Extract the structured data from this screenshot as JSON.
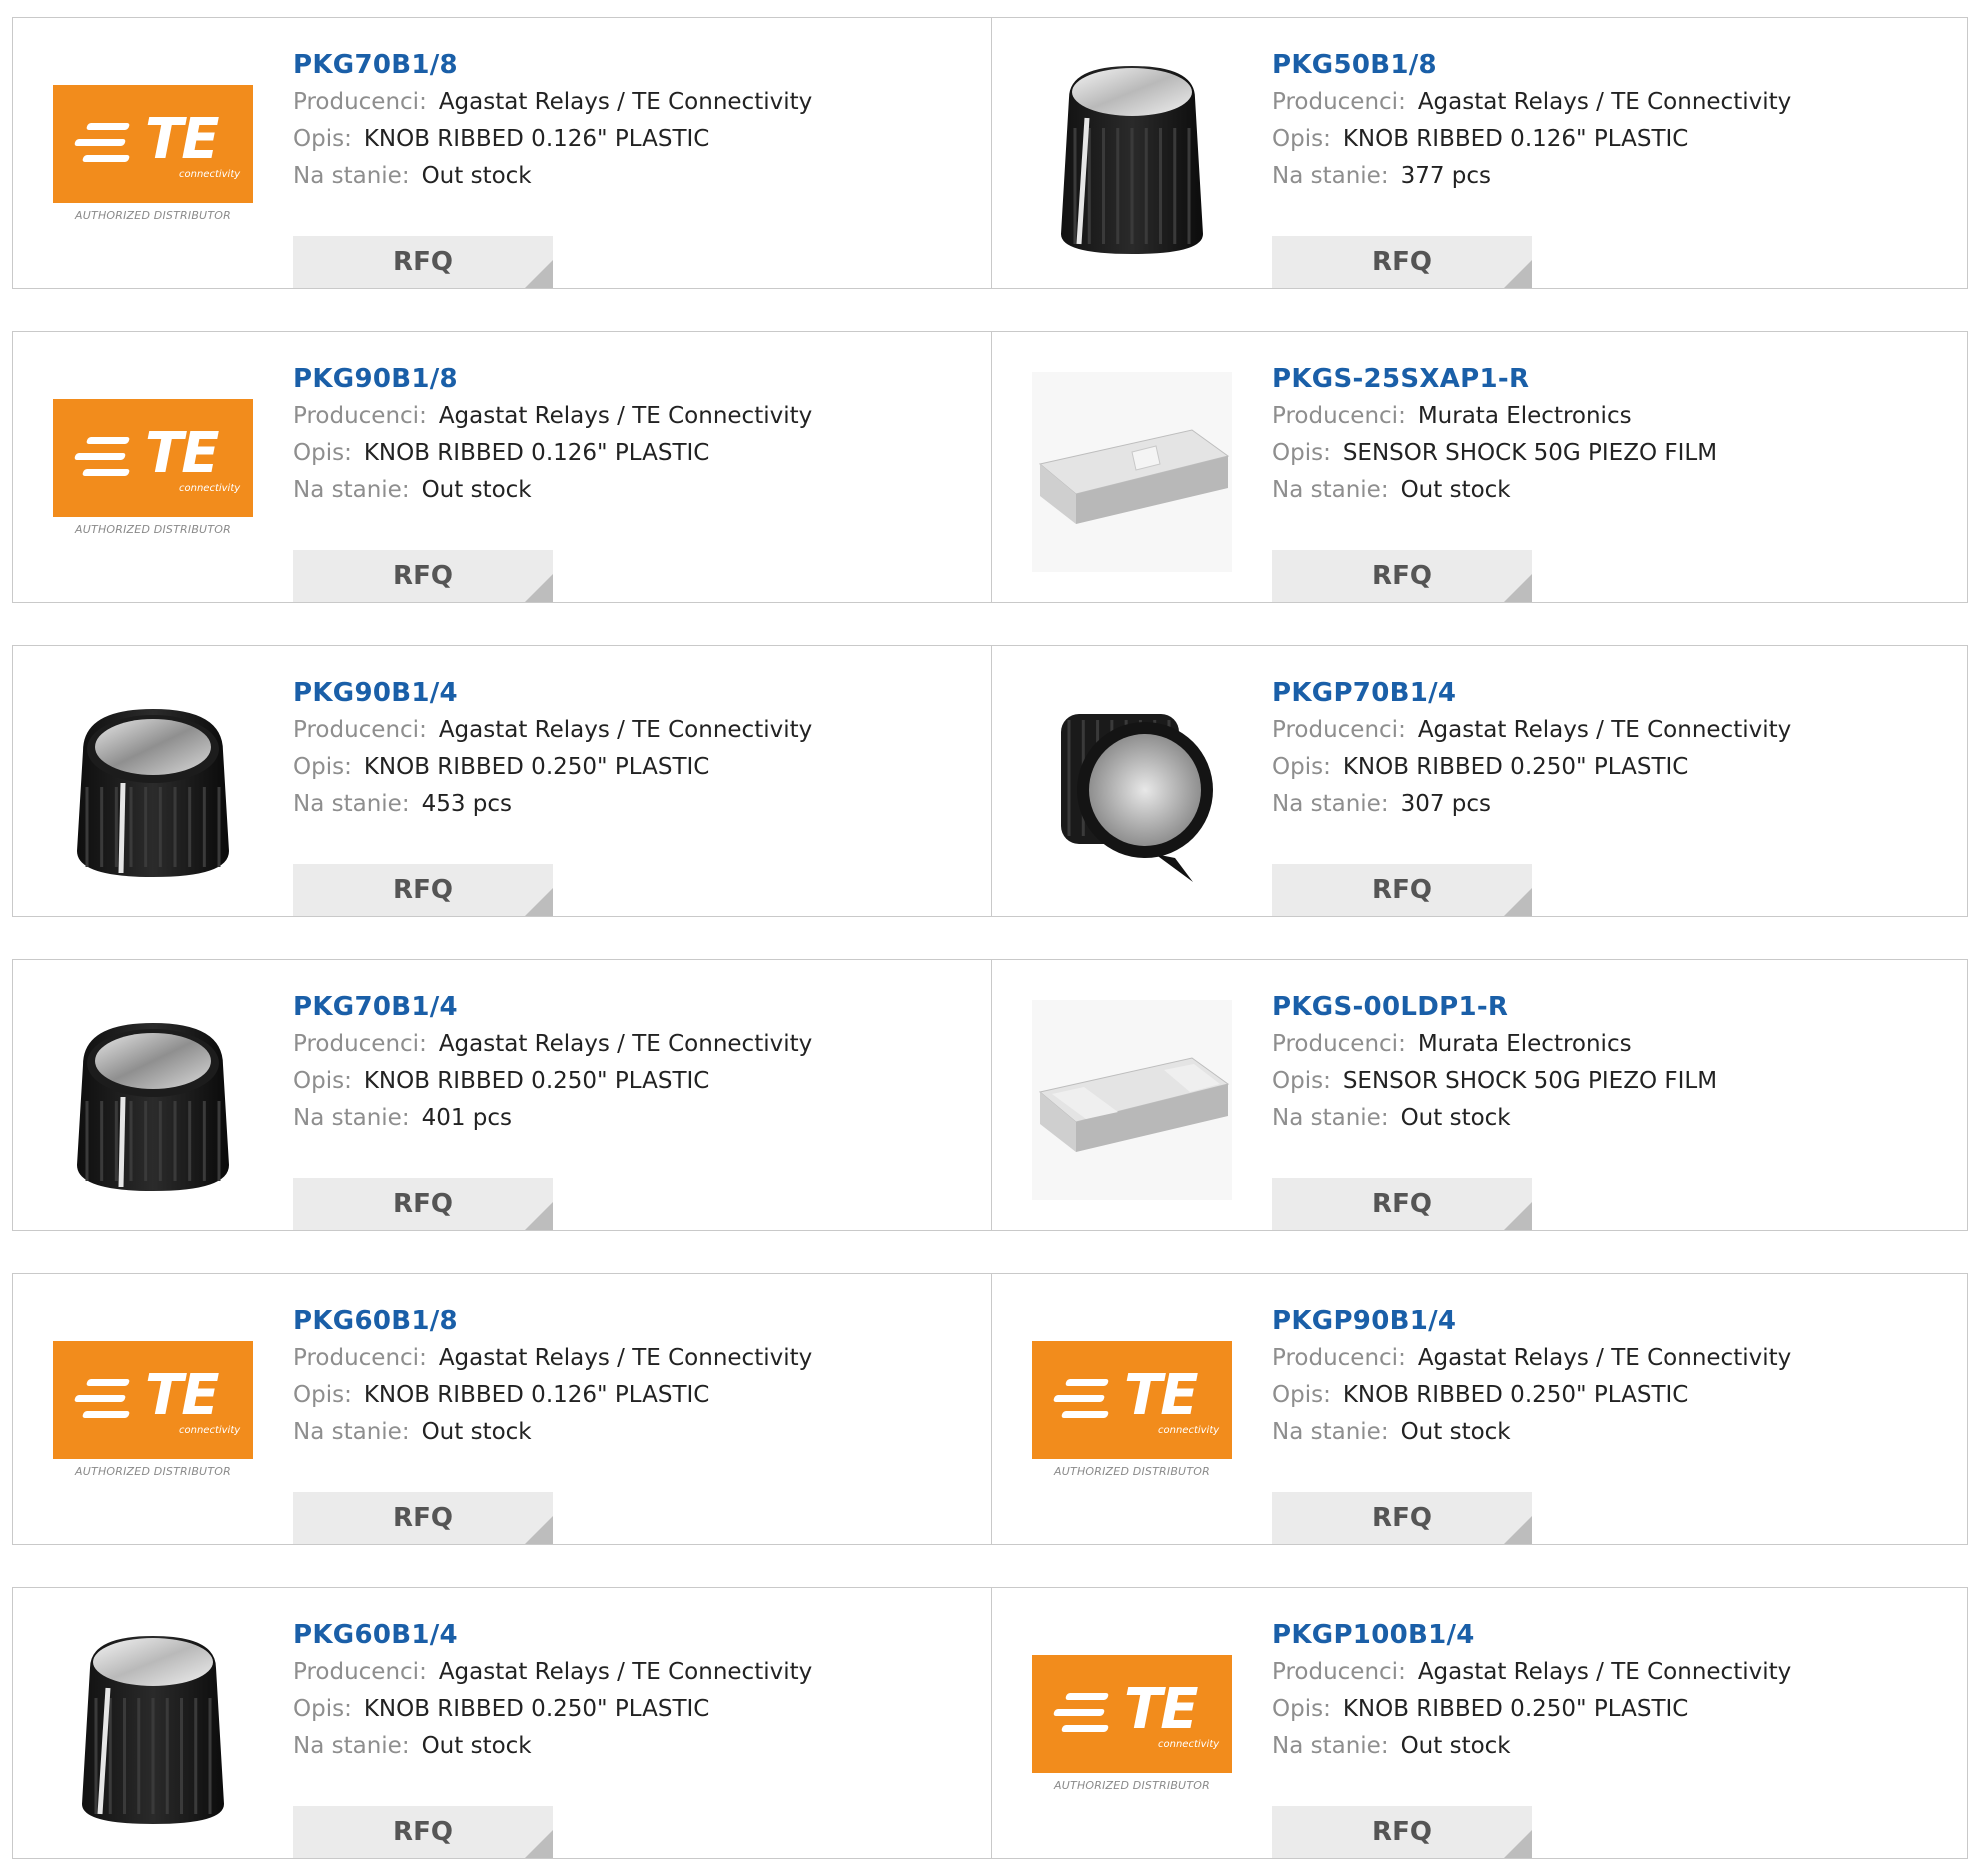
{
  "labels": {
    "manufacturer": "Producenci:",
    "description": "Opis:",
    "stock": "Na stanie:",
    "rfq": "RFQ"
  },
  "logo": {
    "letters": "TE",
    "sub": "connectivity",
    "authorized": "AUTHORIZED DISTRIBUTOR"
  },
  "colors": {
    "part_number_link": "#1a5fa8",
    "te_orange": "#f28c1c",
    "label_gray": "#8e8e8e",
    "rfq_bg": "#ebebeb"
  },
  "products": [
    {
      "part": "PKG70B1/8",
      "manufacturer": "Agastat Relays / TE Connectivity",
      "description": "KNOB RIBBED 0.126\" PLASTIC",
      "stock": "Out stock",
      "image": "te-logo"
    },
    {
      "part": "PKG50B1/8",
      "manufacturer": "Agastat Relays / TE Connectivity",
      "description": "KNOB RIBBED 0.126\" PLASTIC",
      "stock": "377 pcs",
      "image": "tall-knob"
    },
    {
      "part": "PKG90B1/8",
      "manufacturer": "Agastat Relays / TE Connectivity",
      "description": "KNOB RIBBED 0.126\" PLASTIC",
      "stock": "Out stock",
      "image": "te-logo"
    },
    {
      "part": "PKGS-25SXAP1-R",
      "manufacturer": "Murata Electronics",
      "description": "SENSOR SHOCK 50G PIEZO FILM",
      "stock": "Out stock",
      "image": "sensor-notched"
    },
    {
      "part": "PKG90B1/4",
      "manufacturer": "Agastat Relays / TE Connectivity",
      "description": "KNOB RIBBED 0.250\" PLASTIC",
      "stock": "453 pcs",
      "image": "short-knob"
    },
    {
      "part": "PKGP70B1/4",
      "manufacturer": "Agastat Relays / TE Connectivity",
      "description": "KNOB RIBBED 0.250\" PLASTIC",
      "stock": "307 pcs",
      "image": "pointer-knob"
    },
    {
      "part": "PKG70B1/4",
      "manufacturer": "Agastat Relays / TE Connectivity",
      "description": "KNOB RIBBED 0.250\" PLASTIC",
      "stock": "401 pcs",
      "image": "short-knob"
    },
    {
      "part": "PKGS-00LDP1-R",
      "manufacturer": "Murata Electronics",
      "description": "SENSOR SHOCK 50G PIEZO FILM",
      "stock": "Out stock",
      "image": "sensor-plain"
    },
    {
      "part": "PKG60B1/8",
      "manufacturer": "Agastat Relays / TE Connectivity",
      "description": "KNOB RIBBED 0.126\" PLASTIC",
      "stock": "Out stock",
      "image": "te-logo"
    },
    {
      "part": "PKGP90B1/4",
      "manufacturer": "Agastat Relays / TE Connectivity",
      "description": "KNOB RIBBED 0.250\" PLASTIC",
      "stock": "Out stock",
      "image": "te-logo"
    },
    {
      "part": "PKG60B1/4",
      "manufacturer": "Agastat Relays / TE Connectivity",
      "description": "KNOB RIBBED 0.250\" PLASTIC",
      "stock": "Out stock",
      "image": "tall-knob"
    },
    {
      "part": "PKGP100B1/4",
      "manufacturer": "Agastat Relays / TE Connectivity",
      "description": "KNOB RIBBED 0.250\" PLASTIC",
      "stock": "Out stock",
      "image": "te-logo"
    }
  ]
}
